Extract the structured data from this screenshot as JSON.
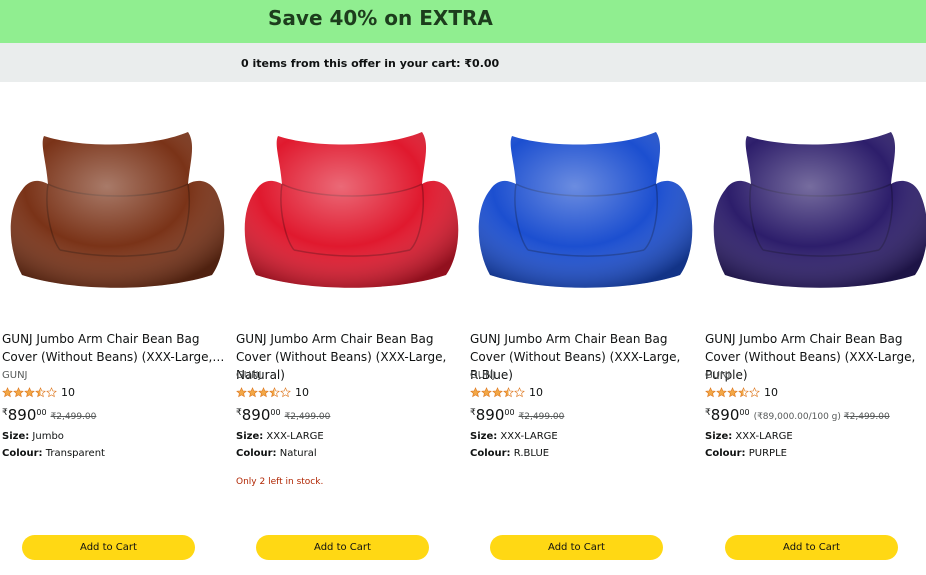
{
  "banner": {
    "title": "Save 40% on EXTRA"
  },
  "cart": {
    "summary": "0 items from this offer in your cart:  ₹0.00"
  },
  "colors": {
    "banner": "#90ee90",
    "cartbar": "#eaeded",
    "button": "#ffd814",
    "stock": "#b12704",
    "star": "#f3a847"
  },
  "products": [
    {
      "title": "GUNJ Jumbo Arm Chair Bean Bag Cover (Without Beans) (XXX-Large,…",
      "brand": "GUNJ",
      "rating": 3.5,
      "rating_count": "10",
      "currency": "₹",
      "price_whole": "890",
      "price_fraction": "00",
      "unit_price": "",
      "mrp": "₹2,499.00",
      "size_label": "Size:",
      "size": "Jumbo",
      "colour_label": "Colour:",
      "colour": "Transparent",
      "stock_note": "",
      "button": "Add to Cart",
      "image_color": "#7a3318",
      "image_icon": "bean-bag-brown-image"
    },
    {
      "title": "GUNJ Jumbo Arm Chair Bean Bag Cover (Without Beans) (XXX-Large, Natural)",
      "brand": "GUNJ",
      "rating": 3.5,
      "rating_count": "10",
      "currency": "₹",
      "price_whole": "890",
      "price_fraction": "00",
      "unit_price": "",
      "mrp": "₹2,499.00",
      "size_label": "Size:",
      "size": "XXX-LARGE",
      "colour_label": "Colour:",
      "colour": "Natural",
      "stock_note": "Only 2 left in stock.",
      "button": "Add to Cart",
      "image_color": "#e0192e",
      "image_icon": "bean-bag-red-image"
    },
    {
      "title": "GUNJ Jumbo Arm Chair Bean Bag Cover (Without Beans) (XXX-Large, R.Blue)",
      "brand": "GUNJ",
      "rating": 3.5,
      "rating_count": "10",
      "currency": "₹",
      "price_whole": "890",
      "price_fraction": "00",
      "unit_price": "",
      "mrp": "₹2,499.00",
      "size_label": "Size:",
      "size": "XXX-LARGE",
      "colour_label": "Colour:",
      "colour": "R.BLUE",
      "stock_note": "",
      "button": "Add to Cart",
      "image_color": "#1c4fd0",
      "image_icon": "bean-bag-blue-image"
    },
    {
      "title": "GUNJ Jumbo Arm Chair Bean Bag Cover (Without Beans) (XXX-Large, Purple)",
      "brand": "GUNJ",
      "rating": 3.5,
      "rating_count": "10",
      "currency": "₹",
      "price_whole": "890",
      "price_fraction": "00",
      "unit_price": "(₹89,000.00/100 g)",
      "mrp": "₹2,499.00",
      "size_label": "Size:",
      "size": "XXX-LARGE",
      "colour_label": "Colour:",
      "colour": "PURPLE",
      "stock_note": "",
      "button": "Add to Cart",
      "image_color": "#2d1e6b",
      "image_icon": "bean-bag-purple-image"
    }
  ]
}
